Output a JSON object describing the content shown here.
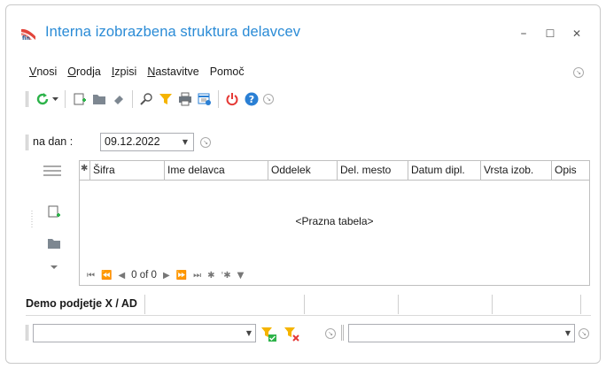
{
  "window": {
    "title": "Interna izobrazbena struktura delavcev",
    "controls": {
      "minimize": "–",
      "maximize": "☐",
      "close": "✕"
    }
  },
  "menu": {
    "items": [
      {
        "label_u": "V",
        "label_rest": "nosi"
      },
      {
        "label_u": "O",
        "label_rest": "rodja"
      },
      {
        "label_u": "I",
        "label_rest": "zpisi"
      },
      {
        "label_u": "N",
        "label_rest": "astavitve"
      },
      {
        "label_u": "",
        "label_rest": "Pomoč"
      }
    ]
  },
  "toolbar": {
    "icons": [
      "refresh-icon",
      "dropdown-icon",
      "new-document-icon",
      "folder-icon",
      "eraser-icon",
      "search-icon",
      "filter-icon",
      "print-icon",
      "export-icon",
      "power-icon",
      "help-icon"
    ]
  },
  "datebar": {
    "label": "na dan :",
    "value": "09.12.2022"
  },
  "grid": {
    "columns": [
      "Šifra",
      "Ime delavca",
      "Oddelek",
      "Del. mesto",
      "Datum dipl.",
      "Vrsta izob.",
      "Opis"
    ],
    "empty_text": "<Prazna tabela>",
    "record_count": "0 of 0"
  },
  "tabs": {
    "active": "Demo podjetje X / AD"
  },
  "colors": {
    "title": "#2a8bd6",
    "refresh": "#2db34a",
    "filter": "#f5b400",
    "power": "#e53935",
    "help": "#2a7fd4"
  }
}
